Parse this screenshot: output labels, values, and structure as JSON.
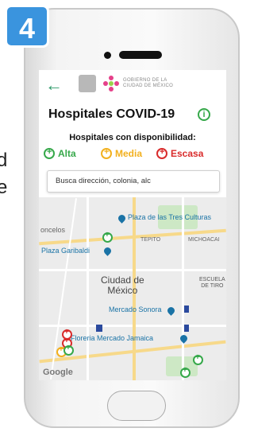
{
  "step_badge": "4",
  "side_text": [
    "d",
    "e"
  ],
  "app": {
    "back_icon": "back-arrow-icon",
    "gov_text": [
      "GOBIERNO DE LA",
      "CIUDAD DE MÉXICO"
    ],
    "title": "Hospitales COVID-19",
    "info_icon": "info-icon",
    "subtitle": "Hospitales con disponibilidad:",
    "legend": [
      {
        "label": "Alta",
        "color": "#36a84a"
      },
      {
        "label": "Media",
        "color": "#f2b01e"
      },
      {
        "label": "Escasa",
        "color": "#d92b2b"
      }
    ],
    "search_placeholder": "Busca dirección, colonia, alc"
  },
  "map": {
    "labels": {
      "plaza_tres_culturas": "Plaza de las Tres Culturas",
      "concelos": "oncelos",
      "tepito": "TEPITO",
      "michoacan": "MICHOACAI",
      "plaza_garibaldi": "Plaza Garibaldi",
      "city": [
        "Ciudad de",
        "México"
      ],
      "escuela": [
        "ESCUELA",
        "DE TIRO"
      ],
      "mercado_sonora": "Mercado Sonora",
      "floreria": "Floreria Mercado Jamaica",
      "google": "Google"
    }
  }
}
